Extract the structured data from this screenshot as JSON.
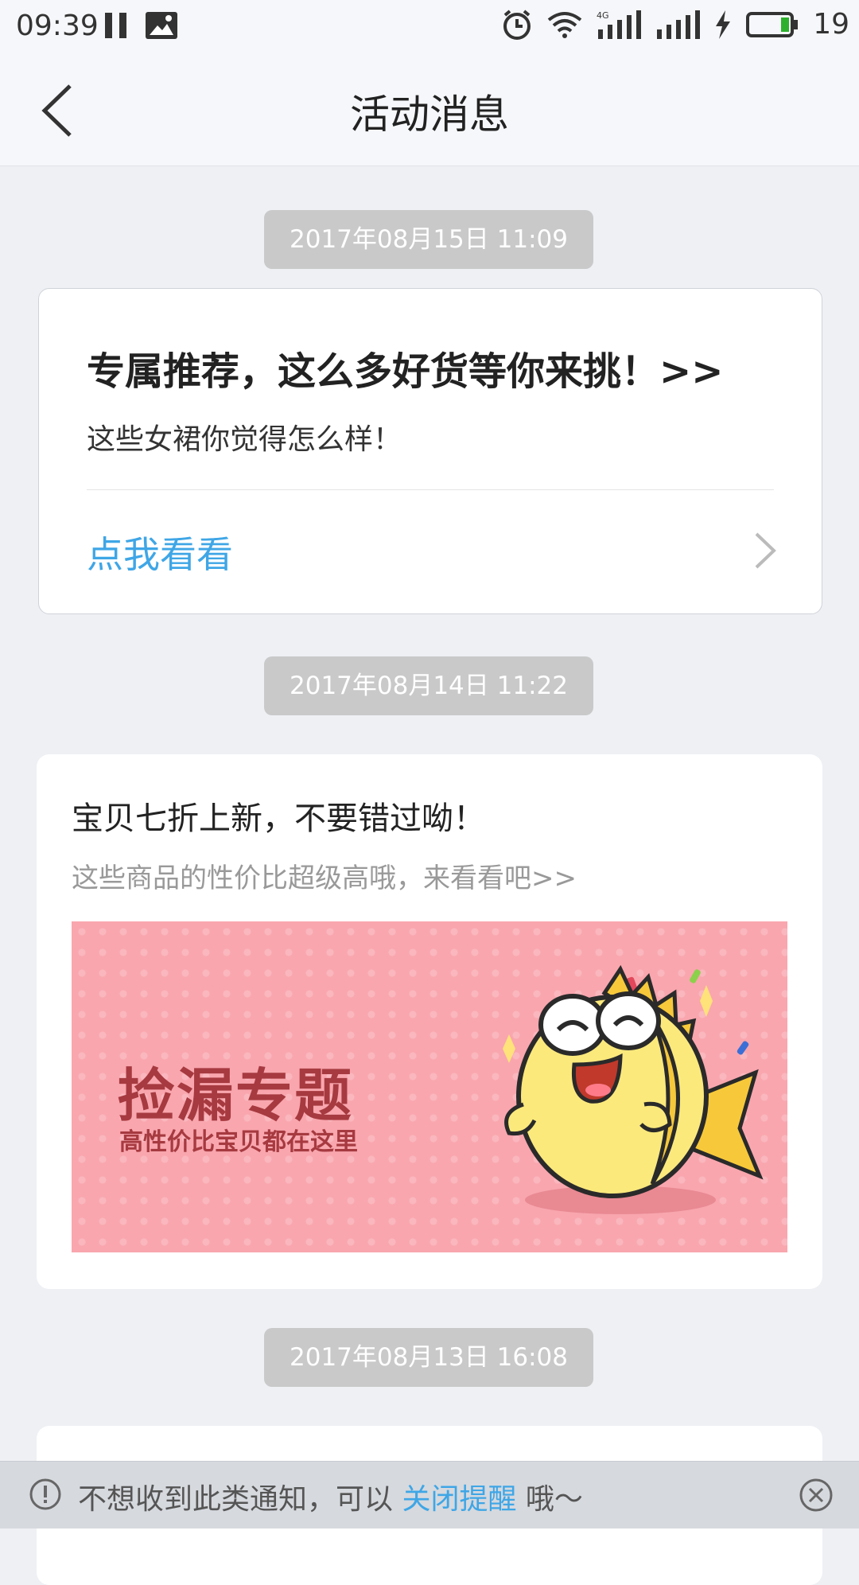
{
  "status": {
    "time": "09:39",
    "battery": "19",
    "network": "4G"
  },
  "nav": {
    "title": "活动消息"
  },
  "messages": [
    {
      "time": "2017年08月15日 11:09",
      "title": "专属推荐，这么多好货等你来挑！>>",
      "subtitle": "这些女裙你觉得怎么样！",
      "link": "点我看看"
    },
    {
      "time": "2017年08月14日 11:22",
      "title": "宝贝七折上新，不要错过呦！",
      "subtitle": "这些商品的性价比超级高哦，来看看吧>>",
      "banner": {
        "title": "捡漏专题",
        "subtitle": "高性价比宝贝都在这里"
      }
    },
    {
      "time": "2017年08月13日 16:08"
    }
  ],
  "footer": {
    "prefix": "不想收到此类通知，可以 ",
    "link": "关闭提醒",
    "suffix": " 哦〜"
  },
  "colors": {
    "accent": "#3fa6e6",
    "banner_bg": "#f9a6ae",
    "badge_bg": "#c9c9c9"
  }
}
